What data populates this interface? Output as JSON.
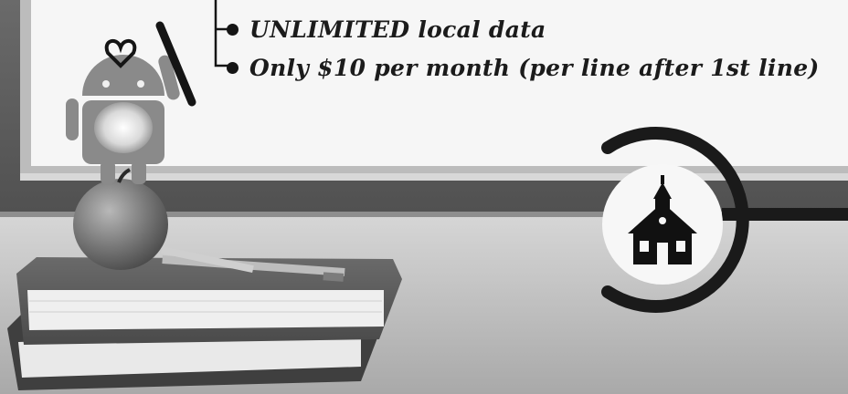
{
  "features": [
    {
      "text": "UNLIMITED local data"
    },
    {
      "text": "Only $10 per month (per line after 1st line)"
    }
  ],
  "icons": {
    "android": "android-mascot-icon",
    "school": "schoolhouse-icon",
    "apple": "apple-icon",
    "pencil": "pencil-icon",
    "books": "book-stack-icon"
  },
  "colors": {
    "whiteboard": "#f6f6f6",
    "frame": "#bdbdbd",
    "wall": "#5e5e5e",
    "desk": "#c7c7c7",
    "accent_ring": "#1a1a1a"
  }
}
